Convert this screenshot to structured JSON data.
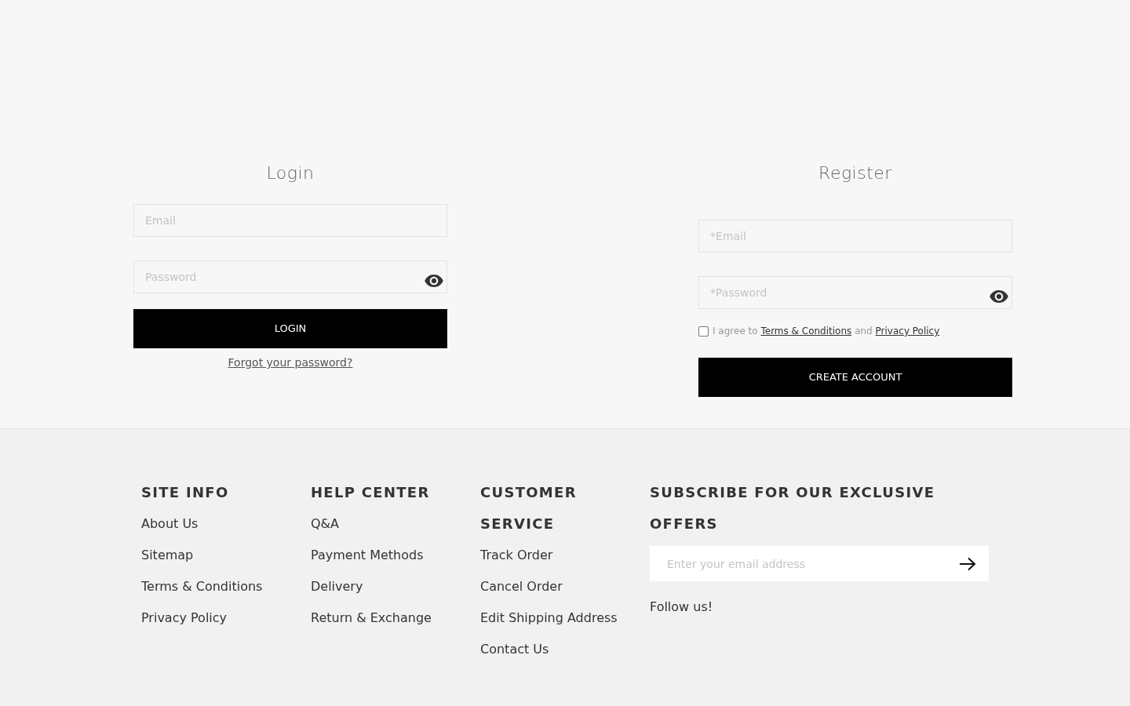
{
  "login": {
    "title": "Login",
    "email": {
      "placeholder": "Email"
    },
    "password": {
      "placeholder": "Password"
    },
    "submit": "LOGIN",
    "forgot_link": "Forgot your password?"
  },
  "register": {
    "title": "Register",
    "email": {
      "placeholder": "*Email"
    },
    "password": {
      "placeholder": "*Password"
    },
    "agreement": {
      "checked": false,
      "prefix": "I agree to",
      "terms_link": "Terms & Conditions",
      "conjunction": "and",
      "privacy_link": "Privacy Policy"
    },
    "submit": "CREATE ACCOUNT"
  },
  "footer": {
    "columns": [
      {
        "heading": "SITE INFO",
        "links": [
          "About Us",
          "Sitemap",
          "Terms & Conditions",
          "Privacy Policy"
        ]
      },
      {
        "heading": "HELP CENTER",
        "links": [
          "Q&A",
          "Payment Methods",
          "Delivery",
          "Return & Exchange"
        ]
      },
      {
        "heading": "CUSTOMER SERVICE",
        "links": [
          "Track Order",
          "Cancel Order",
          "Edit Shipping Address",
          "Contact Us"
        ]
      }
    ],
    "subscribe": {
      "heading": "SUBSCRIBE FOR OUR EXCLUSIVE OFFERS",
      "email": {
        "placeholder": "Enter your email address"
      },
      "follow_label": "Follow us!"
    }
  }
}
